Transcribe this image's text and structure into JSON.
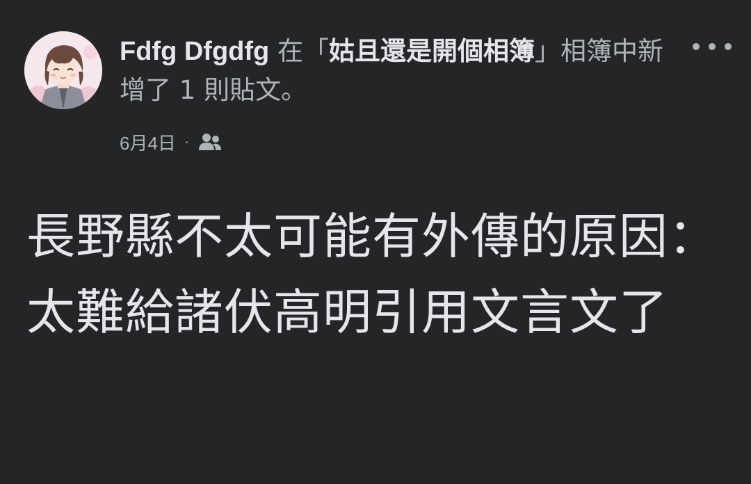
{
  "post": {
    "author": "Fdfg Dfgdfg",
    "action_prefix": " 在「",
    "album_name": "姑且還是開個相簿",
    "action_suffix": "」相簿中新增了 1 則貼文。",
    "date": "6月4日",
    "separator": "·",
    "audience_icon": "friends-icon",
    "more_icon": "more-options-icon",
    "text": "長野縣不太可能有外傳的原因：太難給諸伏高明引用文言文了"
  },
  "colors": {
    "background": "#242526",
    "primary_text": "#e4e6eb",
    "secondary_text": "#b0b3b8"
  }
}
